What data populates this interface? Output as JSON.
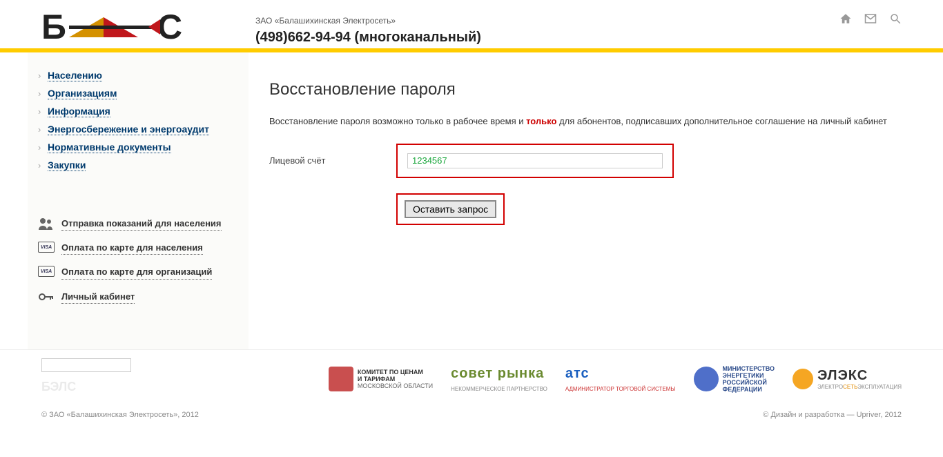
{
  "header": {
    "company_name": "ЗАО «Балашихинская Электросеть»",
    "phone": "(498)662-94-94 (многоканальный)"
  },
  "nav": {
    "items": [
      "Населению",
      "Организациям",
      "Информация",
      "Энергосбережение и энергоаудит",
      "Нормативные документы",
      "Закупки"
    ]
  },
  "service_links": {
    "send_readings": "Отправка показаний для населения",
    "pay_personal": "Оплата по карте для населения",
    "pay_org": "Оплата по карте для организаций",
    "cabinet": "Личный кабинет"
  },
  "content": {
    "title": "Восстановление пароля",
    "intro_pre": "Восстановление пароля возможно только в рабочее время и ",
    "intro_highlight": "только",
    "intro_post": " для абонентов, подписавших дополнительное соглашение на личный кабинет",
    "account_label": "Лицевой счёт",
    "account_value": "1234567",
    "submit_label": "Оставить запрос"
  },
  "partners": {
    "p1_line1": "КОМИТЕТ ПО ЦЕНАМ",
    "p1_line2": "И ТАРИФАМ",
    "p1_line3": "МОСКОВСКОЙ ОБЛАСТИ",
    "p2_line1": "совет рынка",
    "p2_line2": "НЕКОММЕРЧЕСКОЕ ПАРТНЕРСТВО",
    "p3_line1": "атс",
    "p3_line2": "администратор торговой системы",
    "p4_line1": "МИНИСТЕРСТВО",
    "p4_line2": "ЭНЕРГЕТИКИ",
    "p4_line3": "РОССИЙСКОЙ",
    "p4_line4": "ФЕДЕРАЦИИ",
    "p5_line1": "ЭЛЭКС",
    "p5_line2": "ЭЛЕКТРОСЕТЬЭКСПЛУАТАЦИЯ"
  },
  "footer": {
    "copyright": "© ЗАО «Балашихинская Электросеть», 2012",
    "credits": "© Дизайн и разработка — Upriver, 2012"
  }
}
